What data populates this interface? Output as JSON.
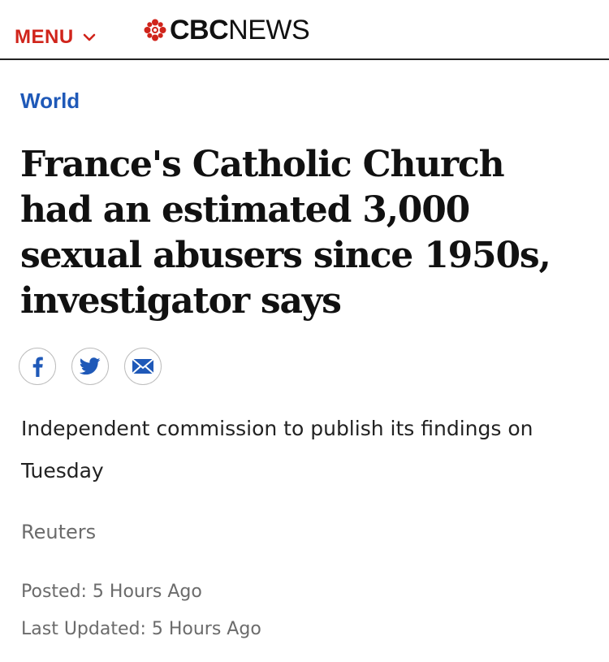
{
  "header": {
    "menu_label": "MENU",
    "logo_bold": "CBC",
    "logo_light": "NEWS",
    "brand_red": "#d0241b"
  },
  "article": {
    "section": "World",
    "section_color": "#1f59b8",
    "headline": "France's Catholic Church had an estimated 3,000 sexual abusers since 1950s, investigator says",
    "deck": "Independent commission to publish its findings on Tuesday",
    "byline": "Reuters",
    "posted": "Posted: 5 Hours Ago",
    "last_updated": "Last Updated: 5 Hours Ago"
  },
  "share": {
    "icons": [
      "facebook-icon",
      "twitter-icon",
      "email-icon"
    ],
    "icon_color": "#1f59b8"
  }
}
